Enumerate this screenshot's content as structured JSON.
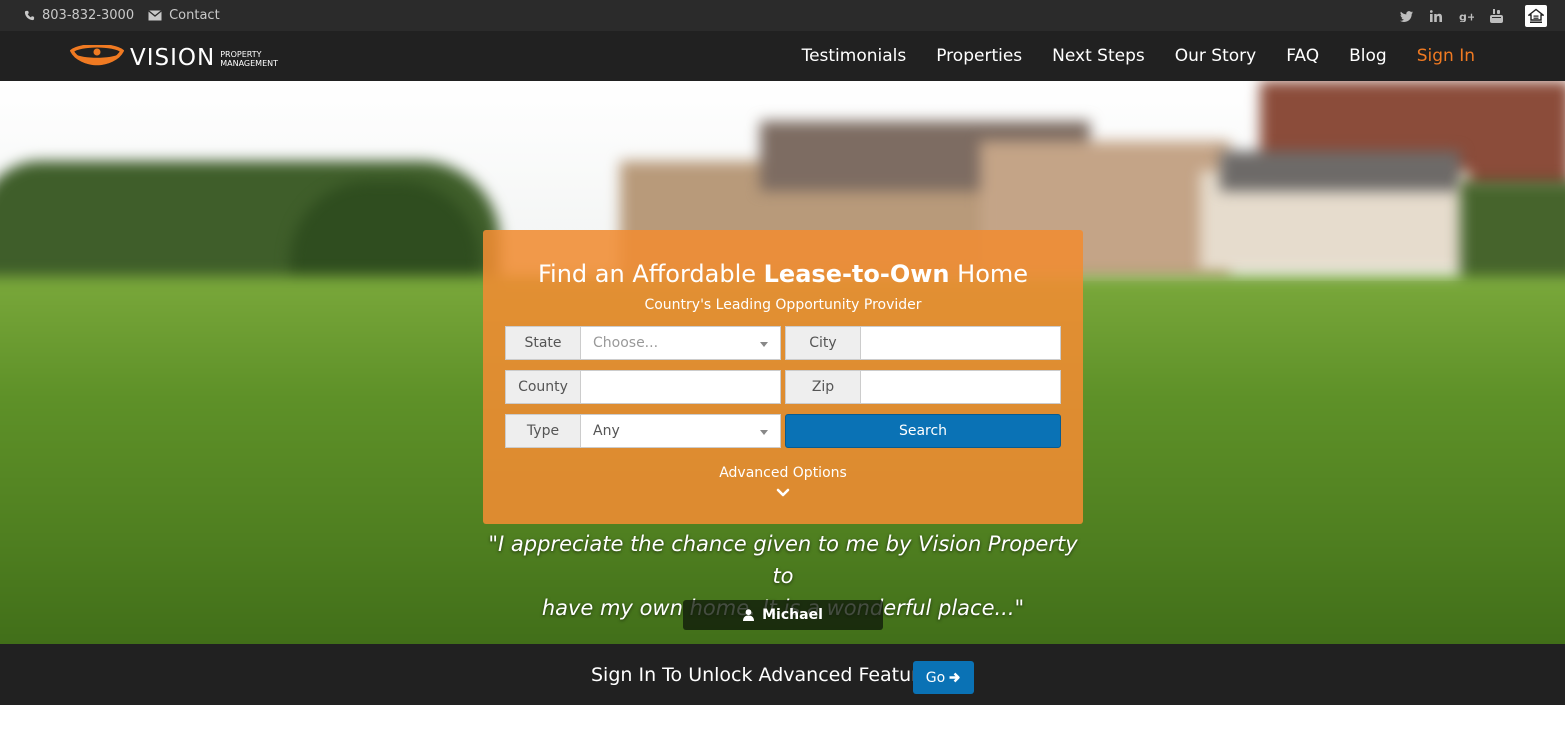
{
  "topbar": {
    "phone": "803-832-3000",
    "contact": "Contact",
    "icons": [
      "phone-icon",
      "envelope-icon",
      "twitter-icon",
      "linkedin-icon",
      "google-plus-icon",
      "youtube-icon",
      "equal-housing-icon"
    ]
  },
  "brand": {
    "name": "VISION",
    "sub_line1": "PROPERTY",
    "sub_line2": "MANAGEMENT",
    "accent": "#f07a22"
  },
  "nav": {
    "items": [
      "Testimonials",
      "Properties",
      "Next Steps",
      "Our Story",
      "FAQ",
      "Blog"
    ],
    "signin": "Sign In"
  },
  "search": {
    "title_pre": "Find an Affordable ",
    "title_bold": "Lease-to-Own",
    "title_post": " Home",
    "tagline": "Country's Leading Opportunity Provider",
    "state_label": "State",
    "state_value": "Choose...",
    "city_label": "City",
    "county_label": "County",
    "zip_label": "Zip",
    "type_label": "Type",
    "type_value": "Any",
    "search_button": "Search",
    "advanced": "Advanced Options",
    "button_color": "#0a72b5"
  },
  "testimonial": {
    "line1": "\"I appreciate the chance given to me by Vision Property to",
    "line2": "have my own home. It is a wonderful place...\"",
    "author": "Michael"
  },
  "bottom": {
    "message": "Sign In To Unlock Advanced Features",
    "go": "Go"
  }
}
